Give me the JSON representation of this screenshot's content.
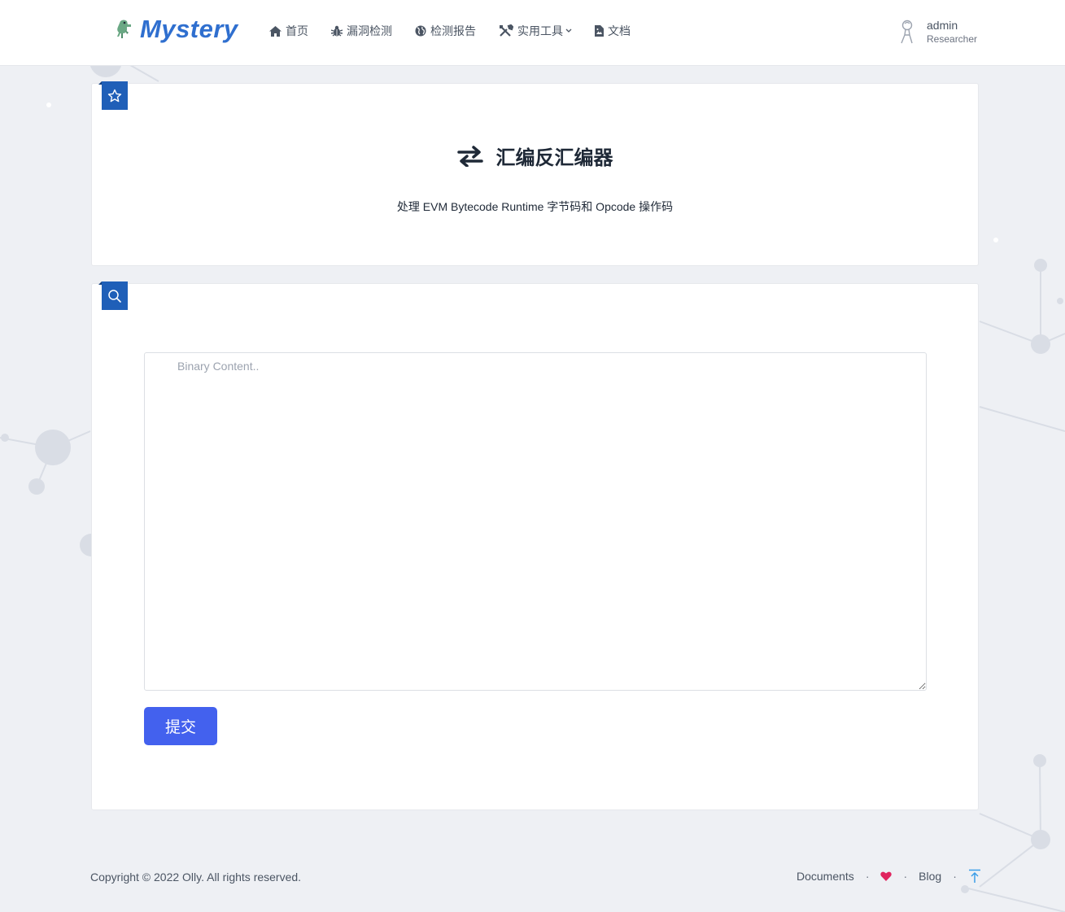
{
  "header": {
    "logo_text": "Mystery",
    "nav": [
      {
        "label": "首页",
        "icon": "home-icon"
      },
      {
        "label": "漏洞检测",
        "icon": "bug-icon"
      },
      {
        "label": "检测报告",
        "icon": "globe-icon"
      },
      {
        "label": "实用工具",
        "icon": "tools-icon",
        "dropdown": true
      },
      {
        "label": "文档",
        "icon": "file-icon"
      }
    ],
    "user": {
      "name": "admin",
      "role": "Researcher"
    }
  },
  "hero": {
    "title": "汇编反汇编器",
    "subtitle": "处理 EVM Bytecode Runtime 字节码和 Opcode 操作码",
    "title_icon": "exchange-icon",
    "tag_icon": "star-icon"
  },
  "form": {
    "tag_icon": "search-icon",
    "placeholder": "Binary Content..",
    "submit_label": "提交"
  },
  "footer": {
    "copyright": "Copyright © 2022 Olly. All rights reserved.",
    "links": {
      "documents": "Documents",
      "blog": "Blog",
      "separator": "·"
    },
    "heart_icon": "heart-icon",
    "top_icon": "arrow-up-icon"
  },
  "colors": {
    "brand": "#2f6fcf",
    "tag": "#1f5fb8",
    "button": "#4361ee",
    "heart": "#e0245e"
  }
}
